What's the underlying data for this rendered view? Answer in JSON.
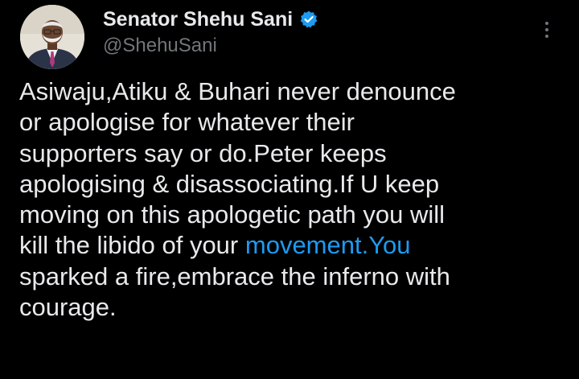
{
  "author": {
    "display_name": "Senator Shehu Sani",
    "handle": "@ShehuSani",
    "avatar_icon": "profile-photo",
    "verified_icon": "verified-badge-icon",
    "verified_color": "#1d9bf0"
  },
  "more_icon": "more-options-icon",
  "tweet": {
    "lines": [
      "Asiwaju,Atiku & Buhari never denounce",
      "or apologise for whatever their",
      "supporters say or do.Peter keeps",
      "apologising & disassociating.If U keep",
      "moving on this apologetic path you will",
      "kill the libido of your ",
      "sparked a fire,embrace the inferno with",
      "courage."
    ],
    "link_text": "movement.You"
  },
  "colors": {
    "background": "#000000",
    "text": "#e7e9ea",
    "secondary_text": "#71767b",
    "link": "#1d9bf0"
  }
}
